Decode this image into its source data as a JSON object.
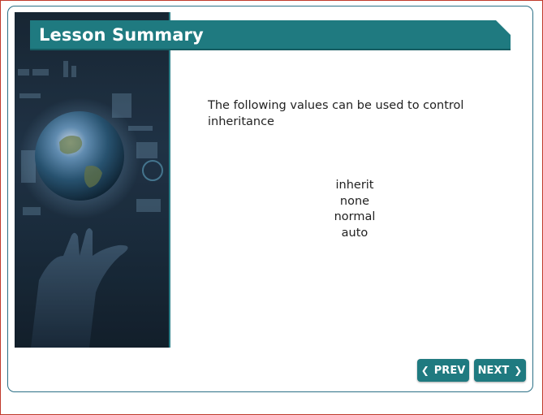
{
  "lesson": {
    "title": "Lesson Summary",
    "intro": "The following values can be used to control inheritance",
    "values": [
      "inherit",
      "none",
      "normal",
      "auto"
    ]
  },
  "nav": {
    "prev_label": "PREV",
    "next_label": "NEXT",
    "prev_icon": "chevron-left-icon",
    "next_icon": "chevron-right-icon"
  },
  "colors": {
    "banner": "#1f7a80",
    "button": "#1f7a80",
    "frame": "#2b6f86"
  }
}
